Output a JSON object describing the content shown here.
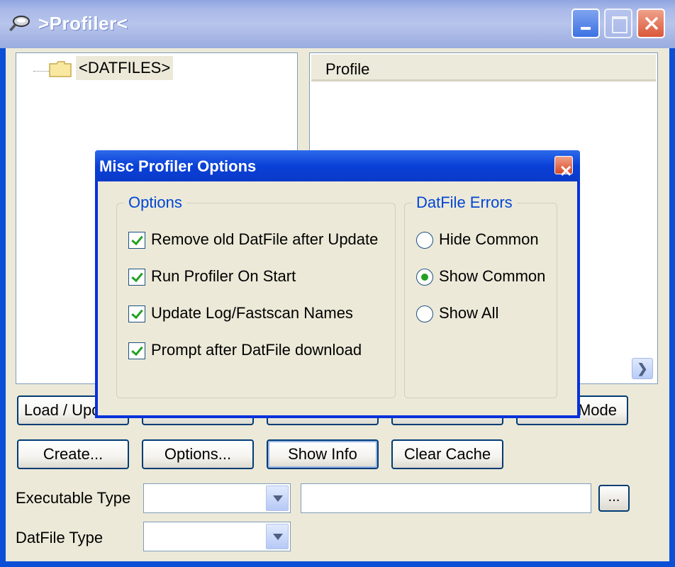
{
  "window": {
    "title": ">Profiler<"
  },
  "tree": {
    "root_label": "<DATFILES>"
  },
  "list": {
    "column_header": "Profile"
  },
  "buttons": {
    "row1": [
      "Load / Update",
      "",
      "",
      "",
      "Mode"
    ],
    "row2": [
      "Create...",
      "Options...",
      "Show Info",
      "Clear Cache"
    ],
    "browse": "..."
  },
  "fields": {
    "executable_type_label": "Executable Type",
    "datfile_type_label": "DatFile Type",
    "executable_type_value": "",
    "datfile_type_value": "",
    "path_value": ""
  },
  "dialog": {
    "title": "Misc Profiler Options",
    "options_group": {
      "title": "Options",
      "items": [
        {
          "label": "Remove old DatFile after Update",
          "checked": true
        },
        {
          "label": "Run Profiler On Start",
          "checked": true
        },
        {
          "label": "Update Log/Fastscan Names",
          "checked": true
        },
        {
          "label": "Prompt after DatFile download",
          "checked": true
        }
      ]
    },
    "errors_group": {
      "title": "DatFile Errors",
      "items": [
        {
          "label": "Hide Common",
          "selected": false
        },
        {
          "label": "Show Common",
          "selected": true
        },
        {
          "label": "Show All",
          "selected": false
        }
      ]
    }
  },
  "colors": {
    "title_bar": "#a9b9e8",
    "dialog_title": "#0a40d8",
    "face": "#ece9d8",
    "group_title": "#0046d5"
  }
}
